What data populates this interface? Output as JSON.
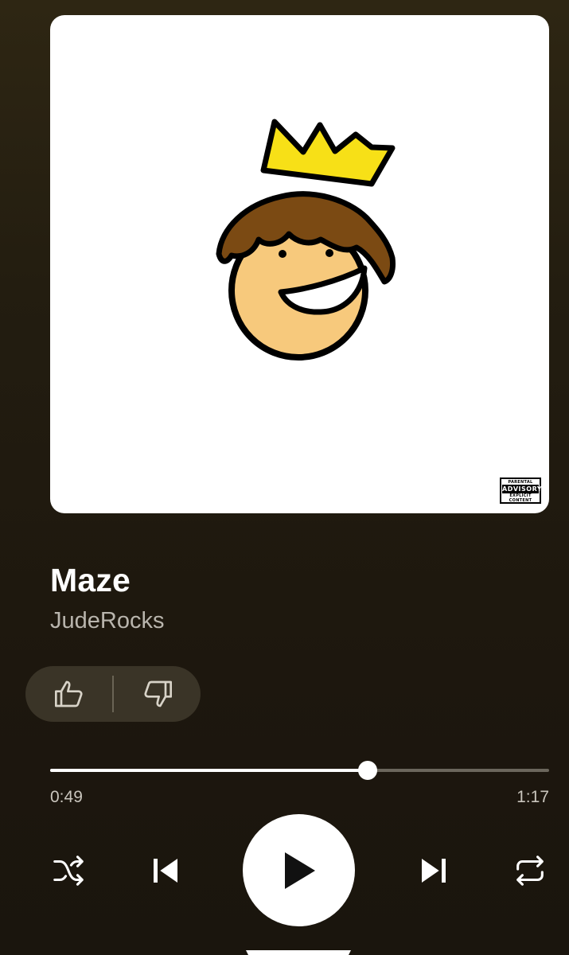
{
  "album": {
    "advisory_top": "PARENTAL",
    "advisory_mid": "ADVISORY",
    "advisory_bottom": "EXPLICIT CONTENT"
  },
  "track": {
    "title": "Maze",
    "artist": "JudeRocks"
  },
  "rating": {
    "like_icon": "thumb-up-icon",
    "dislike_icon": "thumb-down-icon"
  },
  "playback": {
    "elapsed": "0:49",
    "duration": "1:17",
    "progress_fraction": 0.636
  },
  "controls": {
    "shuffle_icon": "shuffle-icon",
    "previous_icon": "skip-previous-icon",
    "play_icon": "play-icon",
    "next_icon": "skip-next-icon",
    "repeat_icon": "repeat-icon"
  },
  "colors": {
    "background_top": "#2e2613",
    "background_bottom": "#1a150d",
    "accent": "#ffffff",
    "secondary_text": "#b9b5ad"
  }
}
